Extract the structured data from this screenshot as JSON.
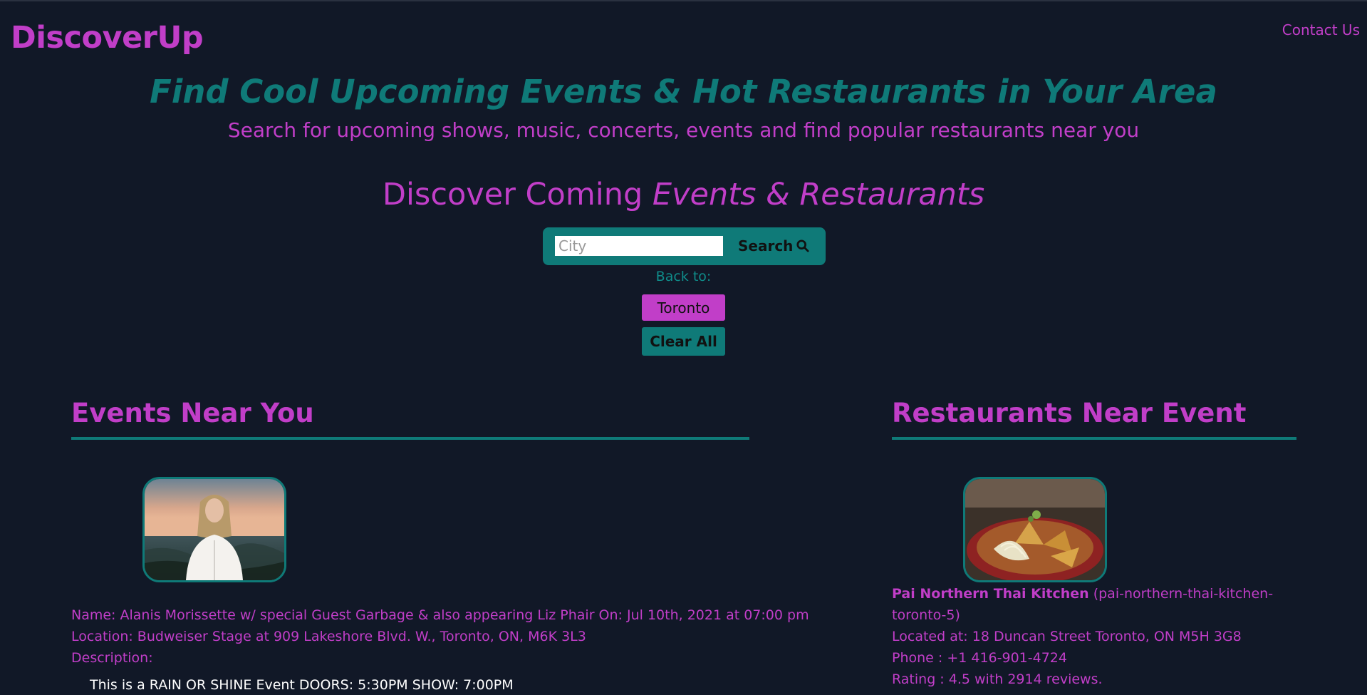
{
  "header": {
    "brand": "DiscoverUp",
    "contact_label": "Contact Us"
  },
  "hero": {
    "title": "Find Cool Upcoming Events & Hot Restaurants in Your Area",
    "subtitle": "Search for upcoming shows, music, concerts, events and find popular restaurants near you"
  },
  "discover": {
    "lead": "Discover Coming ",
    "emphasis": "Events & Restaurants"
  },
  "search": {
    "placeholder": "City",
    "value": "",
    "button_label": "Search",
    "button_icon": "search-icon",
    "back_to_label": "Back to:",
    "recent_city": "Toronto",
    "clear_label": "Clear All"
  },
  "events": {
    "heading": "Events Near You",
    "items": [
      {
        "image": "event-photo",
        "name_line": "Name: Alanis Morissette w/ special Guest Garbage & also appearing Liz Phair On: Jul 10th, 2021 at 07:00 pm",
        "location_line": "Location: Budweiser Stage at 909 Lakeshore Blvd. W., Toronto, ON, M6K 3L3",
        "description_label": "Description:",
        "description": "This is a RAIN OR SHINE Event DOORS: 5:30PM SHOW: 7:00PM"
      }
    ]
  },
  "restaurants": {
    "heading": "Restaurants Near Event",
    "items": [
      {
        "image": "restaurant-photo",
        "name": "Pai Northern Thai Kitchen",
        "slug": "(pai-northern-thai-kitchen-toronto-5)",
        "address_line": "Located at: 18 Duncan Street Toronto, ON M5H 3G8",
        "phone_line": "Phone : +1 416-901-4724",
        "rating_line": "Rating : 4.5 with 2914 reviews."
      }
    ]
  },
  "colors": {
    "background": "#111827",
    "magenta": "#c13ec8",
    "teal": "#0f7a78",
    "white": "#ffffff"
  }
}
